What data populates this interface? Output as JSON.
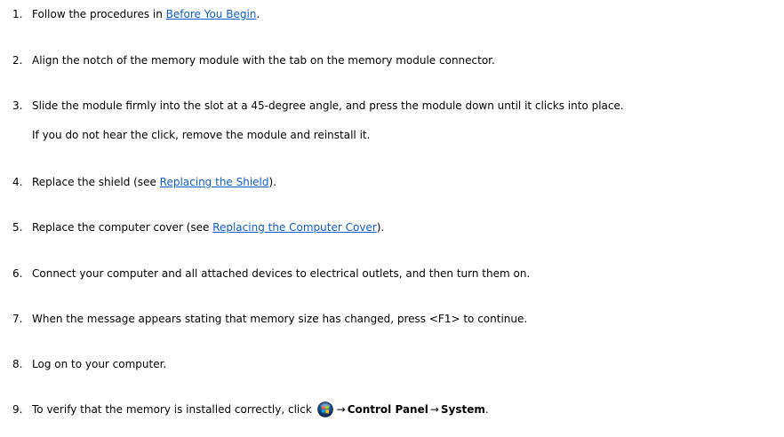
{
  "steps": [
    {
      "num": "1.",
      "pre": "Follow the procedures in ",
      "link": "Before You Begin",
      "post": "."
    },
    {
      "num": "2.",
      "text": "Align the notch of the memory module with the tab on the memory module connector."
    },
    {
      "num": "3.",
      "text": "Slide the module firmly into the slot at a 45-degree angle, and press the module down until it clicks into place.",
      "note": "If you do not hear the click, remove the module and reinstall it."
    },
    {
      "num": "4.",
      "pre": "Replace the shield (see ",
      "link": "Replacing the Shield",
      "post": ")."
    },
    {
      "num": "5.",
      "pre": "Replace the computer cover (see ",
      "link": "Replacing the Computer Cover",
      "post": ")."
    },
    {
      "num": "6.",
      "text": "Connect your computer and all attached devices to electrical outlets, and then turn them on."
    },
    {
      "num": "7.",
      "text": "When the message appears stating that memory size has changed, press <F1> to continue."
    },
    {
      "num": "8.",
      "text": "Log on to your computer."
    },
    {
      "num": "9.",
      "pre": "To verify that the memory is installed correctly, click ",
      "arrow1": "→",
      "bold1": "Control Panel",
      "arrow2": "→",
      "bold2": "System",
      "post": "."
    }
  ],
  "icons": {
    "start_button": "windows-start-orb-icon"
  }
}
